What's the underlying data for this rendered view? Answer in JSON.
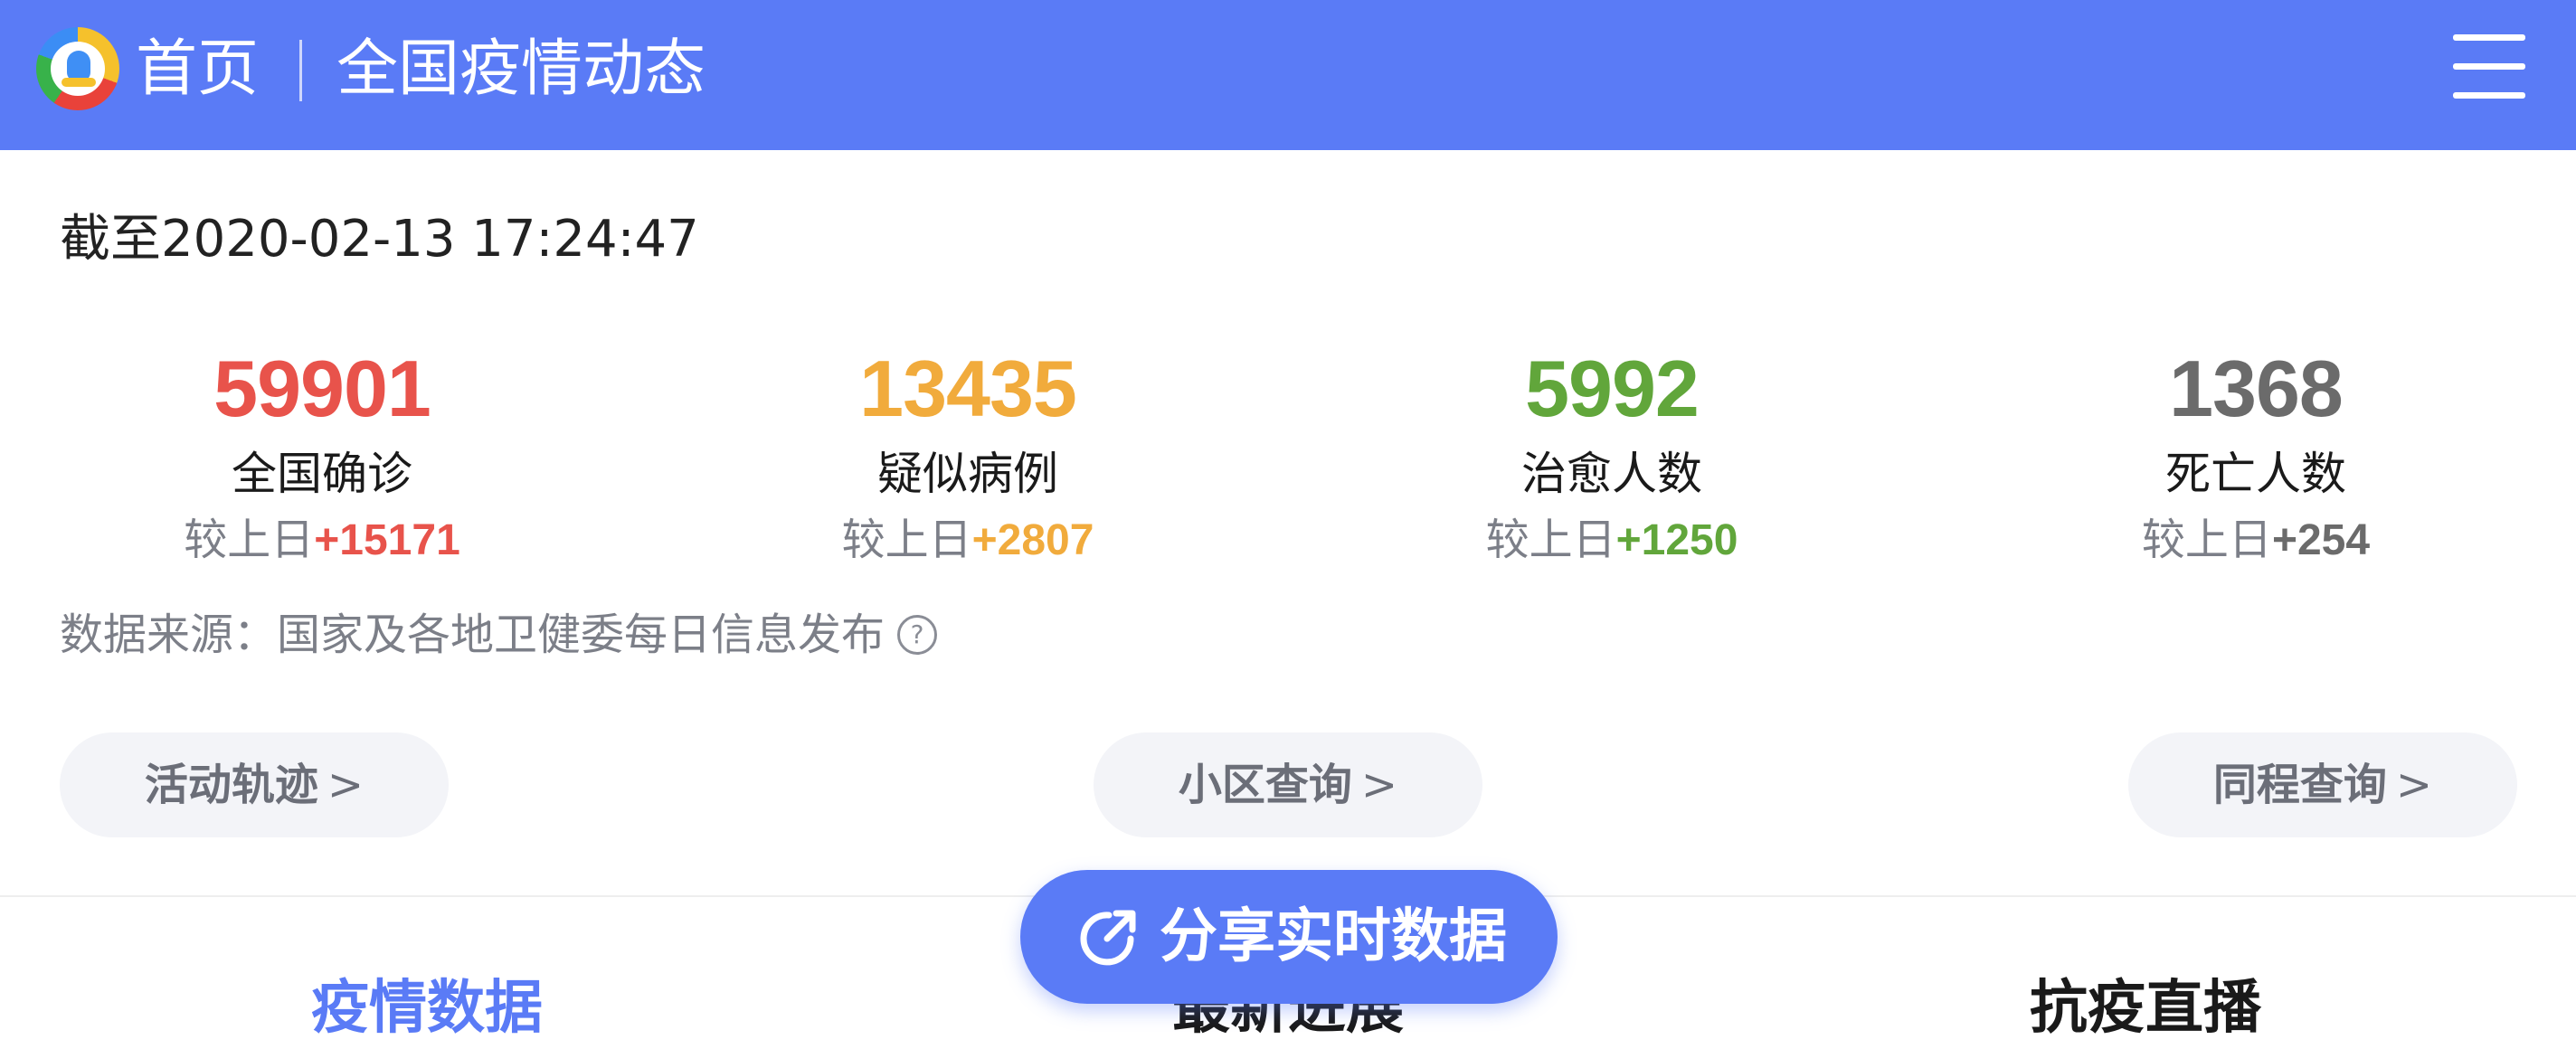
{
  "header": {
    "home_label": "首页",
    "title": "全国疫情动态",
    "bg_color": "#5a7bf6",
    "logo_icon": "tencent-news-logo",
    "menu_icon": "hamburger-menu-icon"
  },
  "update_time": "截至2020-02-13 17:24:47",
  "stats": [
    {
      "value": "59901",
      "label": "全国确诊",
      "change_prefix": "较上日",
      "change": "+15171",
      "color": "#e8534b"
    },
    {
      "value": "13435",
      "label": "疑似病例",
      "change_prefix": "较上日",
      "change": "+2807",
      "color": "#f1ab3c"
    },
    {
      "value": "5992",
      "label": "治愈人数",
      "change_prefix": "较上日",
      "change": "+1250",
      "color": "#61a63b"
    },
    {
      "value": "1368",
      "label": "死亡人数",
      "change_prefix": "较上日",
      "change": "+254",
      "color": "#6b6b6b"
    }
  ],
  "data_source": "数据来源：国家及各地卫健委每日信息发布",
  "help_icon_glyph": "?",
  "buttons": {
    "activity_track": "活动轨迹",
    "community_query": "小区查询",
    "same_trip_query": "同程查询",
    "chevron": ">"
  },
  "share_button": {
    "label": "分享实时数据",
    "icon": "share-icon"
  },
  "tabs": [
    {
      "label": "疫情数据",
      "active": true
    },
    {
      "label": "最新进展",
      "active": false
    },
    {
      "label": "抗疫直播",
      "active": false
    }
  ]
}
